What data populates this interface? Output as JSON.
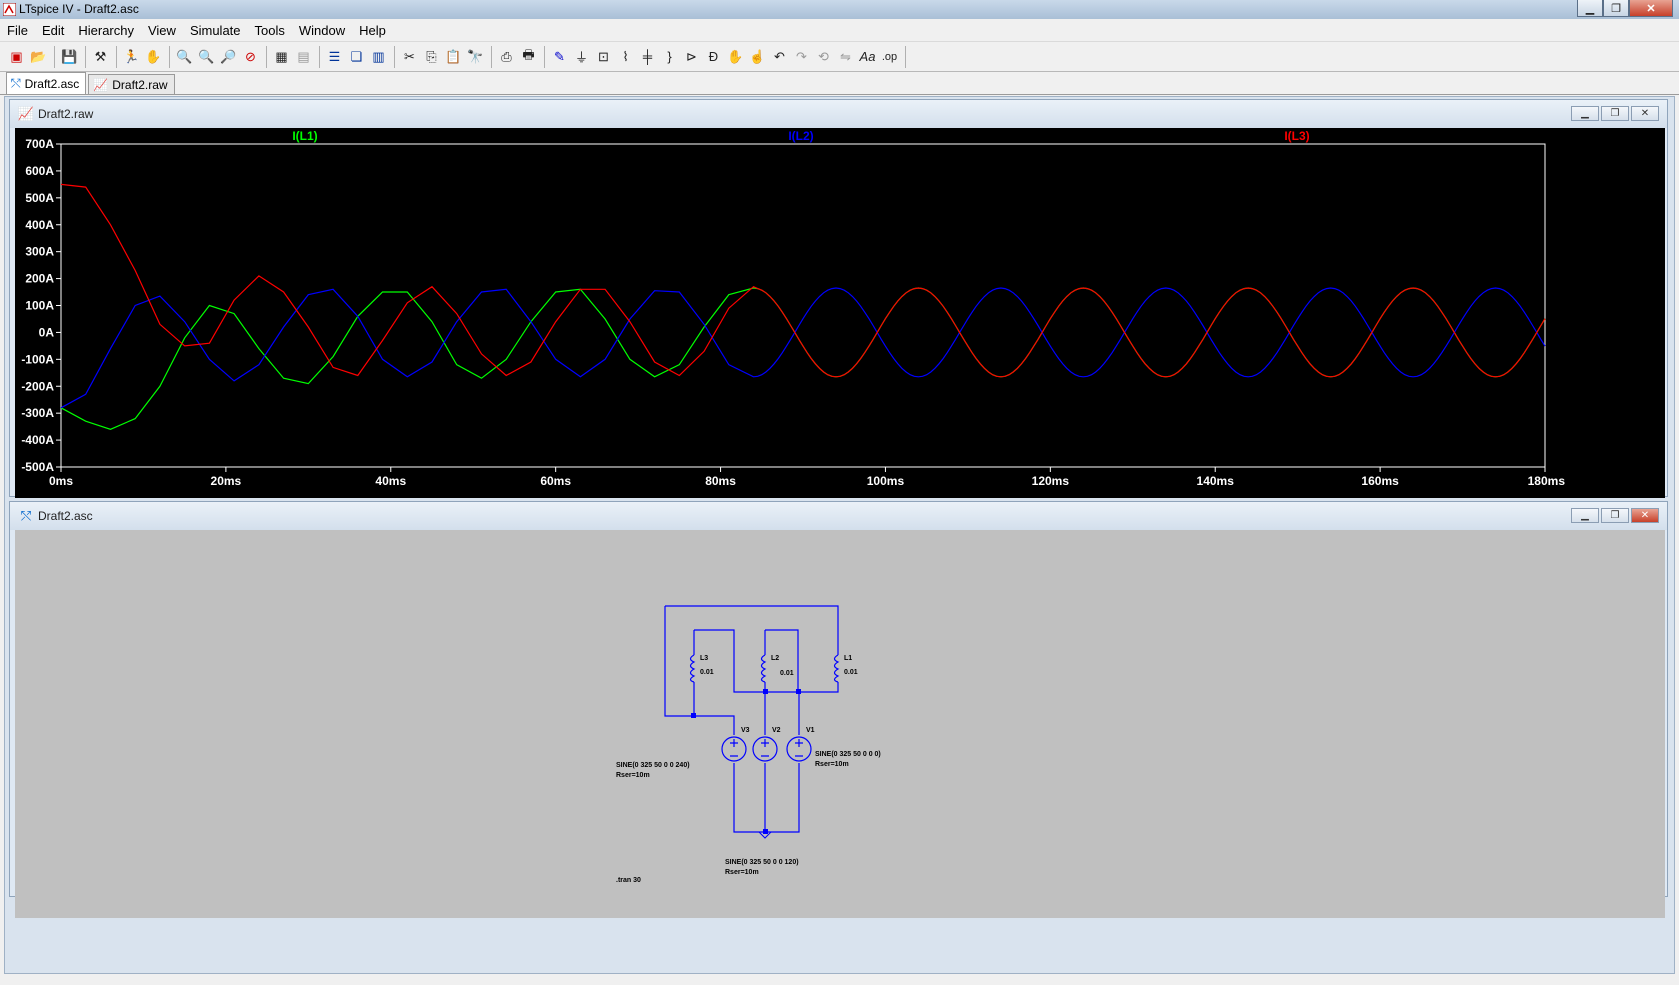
{
  "app": {
    "title": "LTspice IV - Draft2.asc"
  },
  "menu": [
    "File",
    "Edit",
    "Hierarchy",
    "View",
    "Simulate",
    "Tools",
    "Window",
    "Help"
  ],
  "tabs": [
    {
      "label": "Draft2.asc",
      "active": true
    },
    {
      "label": "Draft2.raw",
      "active": false
    }
  ],
  "waveform_window": {
    "title": "Draft2.raw"
  },
  "schematic_window": {
    "title": "Draft2.asc"
  },
  "colors": {
    "L1": "#00ff00",
    "L2": "#0000ff",
    "L3": "#ff0000",
    "wire": "#0000ff"
  },
  "chart_data": {
    "type": "line",
    "title": "",
    "xlabel": "",
    "ylabel": "",
    "xlim": [
      0,
      180
    ],
    "ylim": [
      -500,
      700
    ],
    "x_ticks": [
      "0ms",
      "20ms",
      "40ms",
      "60ms",
      "80ms",
      "100ms",
      "120ms",
      "140ms",
      "160ms",
      "180ms"
    ],
    "y_ticks": [
      "700A",
      "600A",
      "500A",
      "400A",
      "300A",
      "200A",
      "100A",
      "0A",
      "-100A",
      "-200A",
      "-300A",
      "-400A",
      "-500A"
    ],
    "series": [
      {
        "name": "I(L1)",
        "color": "#00ff00",
        "points": [
          [
            0,
            -280
          ],
          [
            3,
            -330
          ],
          [
            6,
            -360
          ],
          [
            9,
            -320
          ],
          [
            12,
            -200
          ],
          [
            15,
            -20
          ],
          [
            18,
            100
          ],
          [
            21,
            70
          ],
          [
            24,
            -60
          ],
          [
            27,
            -170
          ],
          [
            30,
            -190
          ],
          [
            33,
            -90
          ],
          [
            36,
            60
          ],
          [
            39,
            150
          ],
          [
            42,
            150
          ],
          [
            45,
            40
          ],
          [
            48,
            -120
          ],
          [
            51,
            -170
          ],
          [
            54,
            -100
          ],
          [
            57,
            40
          ],
          [
            60,
            150
          ],
          [
            63,
            160
          ],
          [
            66,
            50
          ],
          [
            69,
            -100
          ],
          [
            72,
            -165
          ],
          [
            75,
            -120
          ],
          [
            78,
            20
          ],
          [
            81,
            140
          ],
          [
            84,
            165
          ]
        ]
      },
      {
        "name": "I(L2)",
        "color": "#0000ff",
        "points": [
          [
            0,
            -280
          ],
          [
            3,
            -230
          ],
          [
            6,
            -60
          ],
          [
            9,
            100
          ],
          [
            12,
            135
          ],
          [
            15,
            40
          ],
          [
            18,
            -100
          ],
          [
            21,
            -180
          ],
          [
            24,
            -120
          ],
          [
            27,
            20
          ],
          [
            30,
            140
          ],
          [
            33,
            160
          ],
          [
            36,
            60
          ],
          [
            39,
            -100
          ],
          [
            42,
            -165
          ],
          [
            45,
            -110
          ],
          [
            48,
            40
          ],
          [
            51,
            150
          ],
          [
            54,
            160
          ],
          [
            57,
            40
          ],
          [
            60,
            -100
          ],
          [
            63,
            -165
          ],
          [
            66,
            -100
          ],
          [
            69,
            50
          ],
          [
            72,
            155
          ],
          [
            75,
            150
          ],
          [
            78,
            30
          ],
          [
            81,
            -120
          ],
          [
            84,
            -165
          ]
        ]
      },
      {
        "name": "I(L3)",
        "color": "#ff0000",
        "points": [
          [
            0,
            550
          ],
          [
            3,
            540
          ],
          [
            6,
            400
          ],
          [
            9,
            230
          ],
          [
            12,
            30
          ],
          [
            15,
            -50
          ],
          [
            18,
            -40
          ],
          [
            21,
            120
          ],
          [
            24,
            210
          ],
          [
            27,
            150
          ],
          [
            30,
            20
          ],
          [
            33,
            -130
          ],
          [
            36,
            -160
          ],
          [
            39,
            -30
          ],
          [
            42,
            110
          ],
          [
            45,
            170
          ],
          [
            48,
            70
          ],
          [
            51,
            -80
          ],
          [
            54,
            -160
          ],
          [
            57,
            -110
          ],
          [
            60,
            40
          ],
          [
            63,
            160
          ],
          [
            66,
            160
          ],
          [
            69,
            40
          ],
          [
            72,
            -110
          ],
          [
            75,
            -160
          ],
          [
            78,
            -70
          ],
          [
            81,
            90
          ],
          [
            84,
            170
          ]
        ]
      }
    ],
    "steady_state": {
      "amplitude": 165,
      "period_ms": 20
    }
  },
  "schematic": {
    "inductors": [
      {
        "ref": "L3",
        "value": "0.01"
      },
      {
        "ref": "L2",
        "value": "0.01"
      },
      {
        "ref": "L1",
        "value": "0.01"
      }
    ],
    "sources": [
      {
        "ref": "V3",
        "spec": "SINE(0 325 50 0 0 240)",
        "rser": "Rser=10m"
      },
      {
        "ref": "V2",
        "spec": "SINE(0 325 50 0 0 120)",
        "rser": "Rser=10m"
      },
      {
        "ref": "V1",
        "spec": "SINE(0 325 50 0 0 0)",
        "rser": "Rser=10m"
      }
    ],
    "directive": ".tran 30"
  },
  "icons": {
    "toolbar": [
      "new-schematic-icon",
      "open-icon",
      "save-icon",
      "control-panel-icon",
      "run-icon",
      "halt-icon",
      "zoom-in-icon",
      "zoom-fit-icon",
      "zoom-out-icon",
      "zoom-cancel-icon",
      "autorange-icon",
      "delete-waveform-icon",
      "tile-horizontal-icon",
      "cascade-icon",
      "tile-vertical-icon",
      "cut-icon",
      "copy-icon",
      "paste-icon",
      "find-icon",
      "print-setup-icon",
      "print-icon",
      "wire-icon",
      "ground-icon",
      "label-icon",
      "resistor-icon",
      "capacitor-icon",
      "inductor-icon",
      "diode-icon",
      "component-icon",
      "move-icon",
      "drag-icon",
      "undo-icon",
      "redo-icon",
      "rotate-icon",
      "mirror-icon",
      "text-icon",
      "spice-directive-icon"
    ]
  }
}
